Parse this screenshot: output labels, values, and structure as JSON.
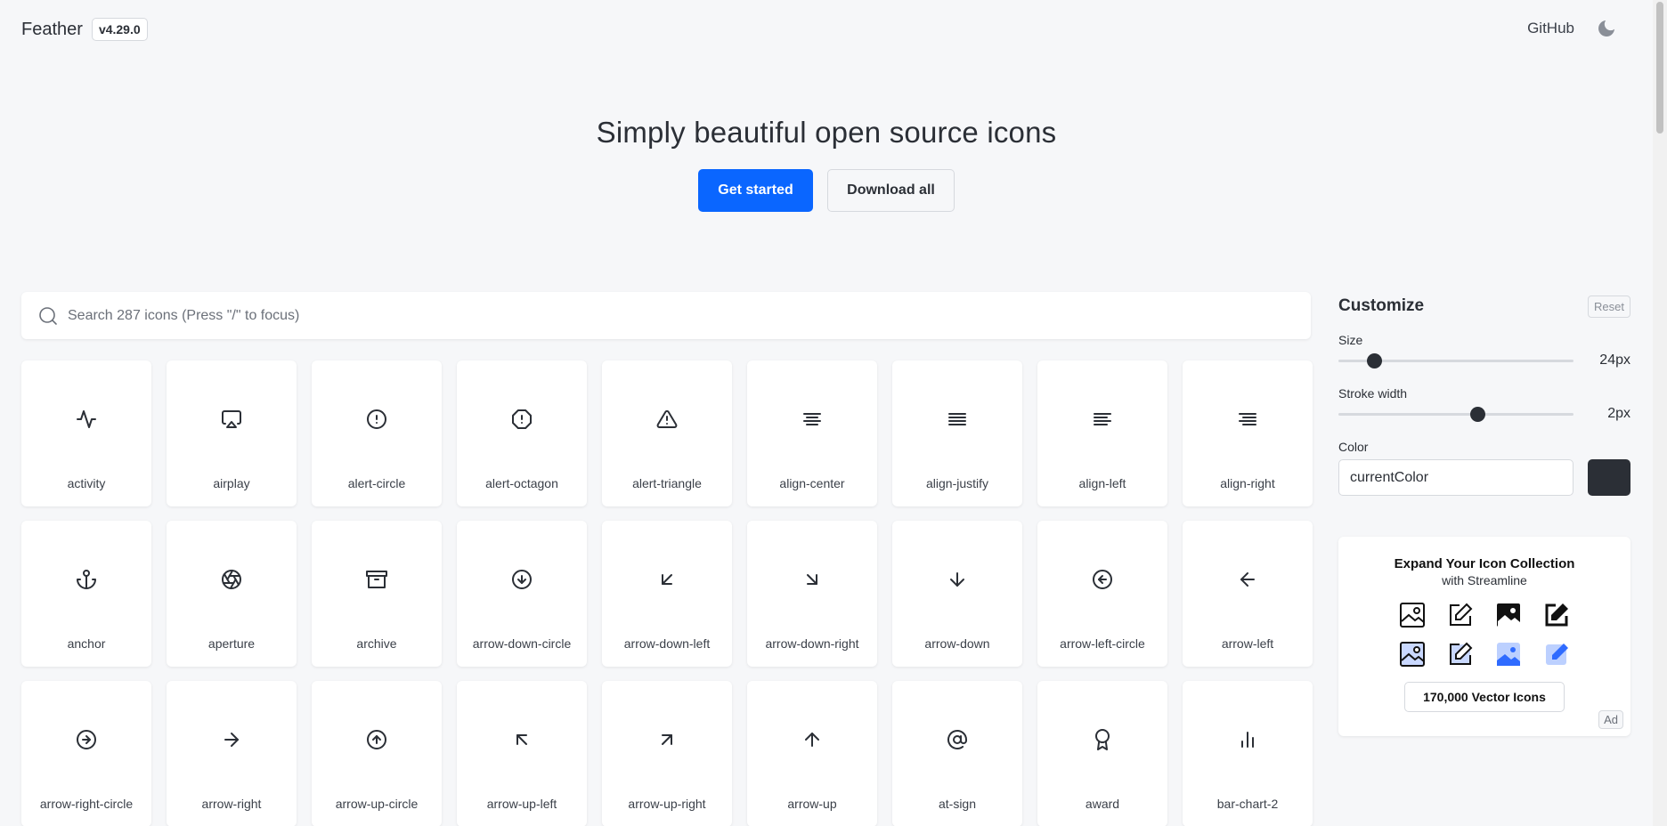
{
  "header": {
    "brand": "Feather",
    "version": "v4.29.0",
    "github": "GitHub"
  },
  "hero": {
    "title": "Simply beautiful open source icons",
    "primary_button": "Get started",
    "secondary_button": "Download all"
  },
  "search": {
    "placeholder": "Search 287 icons (Press \"/\" to focus)"
  },
  "icons": [
    {
      "name": "activity",
      "icon": "activity-icon"
    },
    {
      "name": "airplay",
      "icon": "airplay-icon"
    },
    {
      "name": "alert-circle",
      "icon": "alert-circle-icon"
    },
    {
      "name": "alert-octagon",
      "icon": "alert-octagon-icon"
    },
    {
      "name": "alert-triangle",
      "icon": "alert-triangle-icon"
    },
    {
      "name": "align-center",
      "icon": "align-center-icon"
    },
    {
      "name": "align-justify",
      "icon": "align-justify-icon"
    },
    {
      "name": "align-left",
      "icon": "align-left-icon"
    },
    {
      "name": "align-right",
      "icon": "align-right-icon"
    },
    {
      "name": "anchor",
      "icon": "anchor-icon"
    },
    {
      "name": "aperture",
      "icon": "aperture-icon"
    },
    {
      "name": "archive",
      "icon": "archive-icon"
    },
    {
      "name": "arrow-down-circle",
      "icon": "arrow-down-circle-icon"
    },
    {
      "name": "arrow-down-left",
      "icon": "arrow-down-left-icon"
    },
    {
      "name": "arrow-down-right",
      "icon": "arrow-down-right-icon"
    },
    {
      "name": "arrow-down",
      "icon": "arrow-down-icon"
    },
    {
      "name": "arrow-left-circle",
      "icon": "arrow-left-circle-icon"
    },
    {
      "name": "arrow-left",
      "icon": "arrow-left-icon"
    },
    {
      "name": "arrow-right-circle",
      "icon": "arrow-right-circle-icon"
    },
    {
      "name": "arrow-right",
      "icon": "arrow-right-icon"
    },
    {
      "name": "arrow-up-circle",
      "icon": "arrow-up-circle-icon"
    },
    {
      "name": "arrow-up-left",
      "icon": "arrow-up-left-icon"
    },
    {
      "name": "arrow-up-right",
      "icon": "arrow-up-right-icon"
    },
    {
      "name": "arrow-up",
      "icon": "arrow-up-icon"
    },
    {
      "name": "at-sign",
      "icon": "at-sign-icon"
    },
    {
      "name": "award",
      "icon": "award-icon"
    },
    {
      "name": "bar-chart-2",
      "icon": "bar-chart-2-icon"
    }
  ],
  "customize": {
    "title": "Customize",
    "reset": "Reset",
    "size_label": "Size",
    "size_value": "24px",
    "size_fraction": 0.15,
    "stroke_label": "Stroke width",
    "stroke_value": "2px",
    "stroke_fraction": 0.59,
    "color_label": "Color",
    "color_value": "currentColor",
    "swatch_color": "#2b2f36"
  },
  "ad": {
    "title": "Expand Your Icon Collection",
    "subtitle": "with Streamline",
    "cta": "170,000 Vector Icons",
    "badge": "Ad"
  },
  "colors": {
    "accent": "#0a66ff",
    "text": "#2b2f36",
    "background": "#f6f7f9"
  }
}
